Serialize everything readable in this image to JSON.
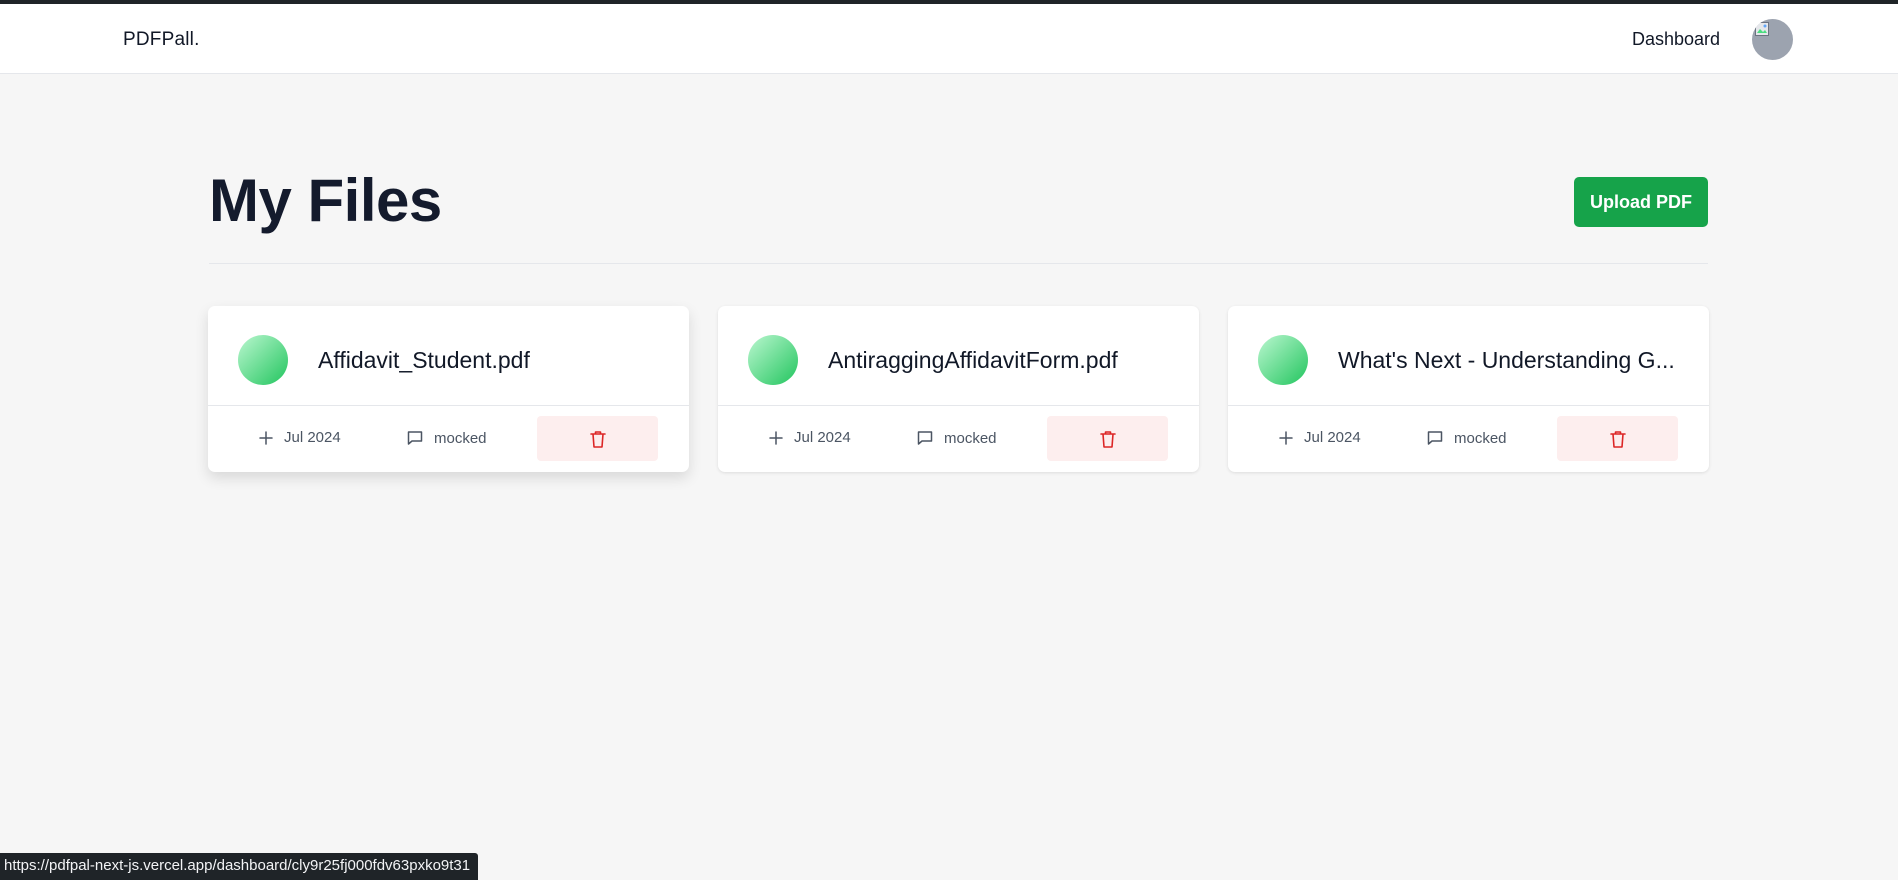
{
  "navbar": {
    "brand": "PDFPall.",
    "dashboard_link": "Dashboard",
    "avatar_icon": "broken-image-icon"
  },
  "main": {
    "title": "My Files",
    "upload_button": "Upload PDF"
  },
  "files": [
    {
      "name": "Affidavit_Student.pdf",
      "date": "Jul 2024",
      "messages": "mocked",
      "date_icon": "plus-icon",
      "message_icon": "message-square-icon",
      "delete_icon": "trash-icon"
    },
    {
      "name": "AntiraggingAffidavitForm.pdf",
      "date": "Jul 2024",
      "messages": "mocked",
      "date_icon": "plus-icon",
      "message_icon": "message-square-icon",
      "delete_icon": "trash-icon"
    },
    {
      "name": "What's Next - Understanding G...",
      "date": "Jul 2024",
      "messages": "mocked",
      "date_icon": "plus-icon",
      "message_icon": "message-square-icon",
      "delete_icon": "trash-icon"
    }
  ],
  "status_bar": {
    "url": "https://pdfpal-next-js.vercel.app/dashboard/cly9r25fj000fdv63pxko9t31"
  },
  "colors": {
    "accent": "#16a34a",
    "file_gradient_start": "#bbf7d0",
    "file_gradient_end": "#22c55e",
    "delete_bg": "#fdeeee",
    "delete_icon": "#dc2626",
    "page_bg": "#f6f6f6"
  }
}
